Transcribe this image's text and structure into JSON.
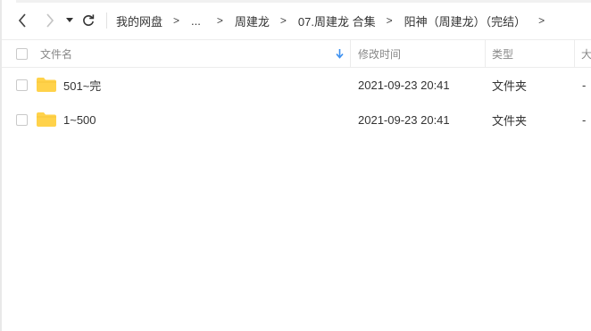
{
  "breadcrumb": [
    "我的网盘",
    "...",
    "周建龙",
    "07.周建龙 合集",
    "阳神（周建龙）（完结）"
  ],
  "breadcrumb_separator": ">",
  "columns": {
    "name": "文件名",
    "modified": "修改时间",
    "type": "类型",
    "size": "大"
  },
  "files": [
    {
      "name": "501~完",
      "modified": "2021-09-23 20:41",
      "type": "文件夹",
      "size": "-"
    },
    {
      "name": "1~500",
      "modified": "2021-09-23 20:41",
      "type": "文件夹",
      "size": "-"
    }
  ],
  "colors": {
    "folder": "#FFD24A",
    "accent": "#3A8FF0",
    "border": "#ECECEC"
  },
  "icons": [
    "back-icon",
    "forward-icon",
    "dropdown-icon",
    "refresh-icon",
    "sort-down-icon",
    "folder-icon"
  ]
}
